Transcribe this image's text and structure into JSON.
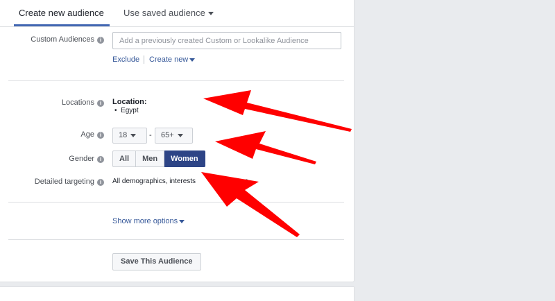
{
  "tabs": {
    "create_label": "Create new audience",
    "saved_label": "Use saved audience"
  },
  "custom_audiences": {
    "label": "Custom Audiences",
    "placeholder": "Add a previously created Custom or Lookalike Audience",
    "exclude_label": "Exclude",
    "create_new_label": "Create new"
  },
  "locations": {
    "label": "Locations",
    "heading": "Location:",
    "items": [
      "Egypt"
    ]
  },
  "age": {
    "label": "Age",
    "min": "18",
    "separator": "-",
    "max": "65+"
  },
  "gender": {
    "label": "Gender",
    "options": [
      "All",
      "Men",
      "Women"
    ],
    "selected": "Women"
  },
  "detailed_targeting": {
    "label": "Detailed targeting",
    "value_before": "All demographics, interests",
    "value_after": "haviours"
  },
  "show_more_label": "Show more options",
  "save_button_label": "Save This Audience",
  "info_glyph": "i",
  "bullet_glyph": "•",
  "colors": {
    "accent": "#4267b2",
    "selected_segment": "#2d4486",
    "annotation_arrow": "#ff0000"
  }
}
